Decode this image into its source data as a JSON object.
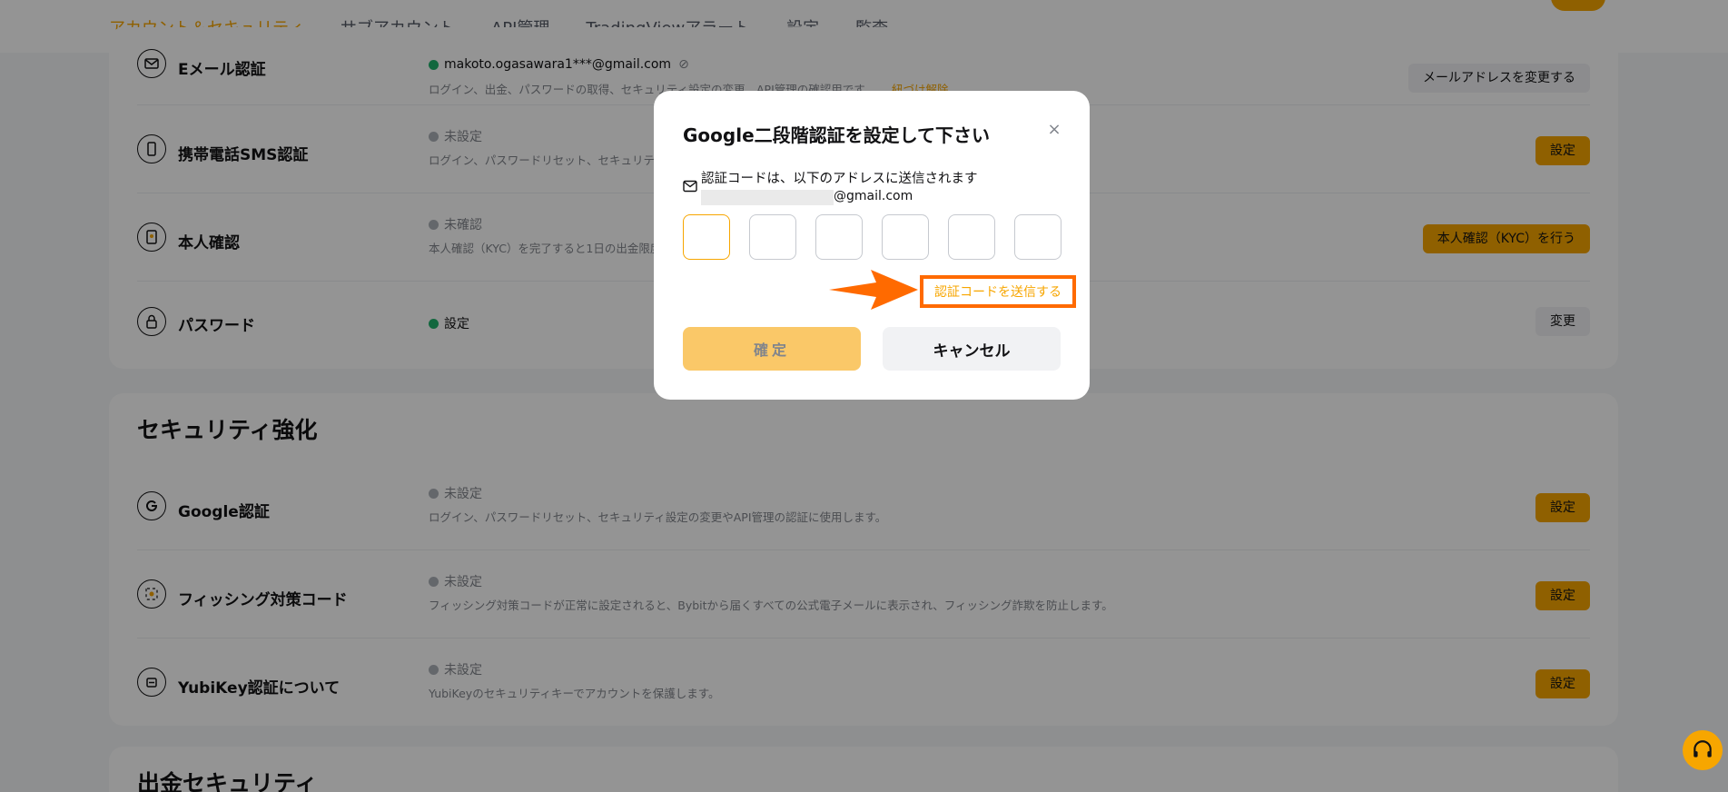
{
  "tabs": [
    {
      "label": "アカウント＆セキュリティ"
    },
    {
      "label": "サブアカウント"
    },
    {
      "label": "API管理"
    },
    {
      "label": "TradingViewアラート"
    },
    {
      "label": "設定"
    },
    {
      "label": "監査"
    }
  ],
  "account_rows": [
    {
      "name": "Eメール認証",
      "status": "makoto.ogasawara1***@gmail.com",
      "desc": "ログイン、出金、パスワードの取得、セキュリティ設定の変更、API管理の確認用です。",
      "link": "紐づけ解除",
      "button": "メールアドレスを変更する"
    },
    {
      "name": "携帯電話SMS認証",
      "status": "未設定",
      "desc": "ログイン、パスワードリセット、セキュリティ",
      "button": "設定"
    },
    {
      "name": "本人確認",
      "status": "未確認",
      "desc": "本人確認（KYC）を完了すると1日の出金限度",
      "button": "本人確認（KYC）を行う"
    },
    {
      "name": "パスワード",
      "status": "設定",
      "button": "変更"
    }
  ],
  "security_section": {
    "title": "セキュリティ強化",
    "rows": [
      {
        "name": "Google認証",
        "status": "未設定",
        "desc": "ログイン、パスワードリセット、セキュリティ設定の変更やAPI管理の認証に使用します。",
        "button": "設定"
      },
      {
        "name": "フィッシング対策コード",
        "status": "未設定",
        "desc": "フィッシング対策コードが正常に設定されると、Bybitから届くすべての公式電子メールに表示され、フィッシング詐欺を防止します。",
        "button": "設定"
      },
      {
        "name": "YubiKey認証について",
        "status": "未設定",
        "desc": "YubiKeyのセキュリティキーでアカウントを保護します。",
        "button": "設定"
      }
    ]
  },
  "withdraw_section": {
    "title": "出金セキュリティ"
  },
  "modal": {
    "title": "Google二段階認証を設定して下さい",
    "close_icon": "×",
    "sent_to": "認証コードは、以下のアドレスに送信されます",
    "email_suffix": "@gmail.com",
    "send_code": "認証コードを送信する",
    "confirm": "確定",
    "cancel": "キャンセル"
  },
  "colors": {
    "accent": "#f7a600",
    "highlight": "#ff6a00",
    "success": "#20b26c"
  }
}
